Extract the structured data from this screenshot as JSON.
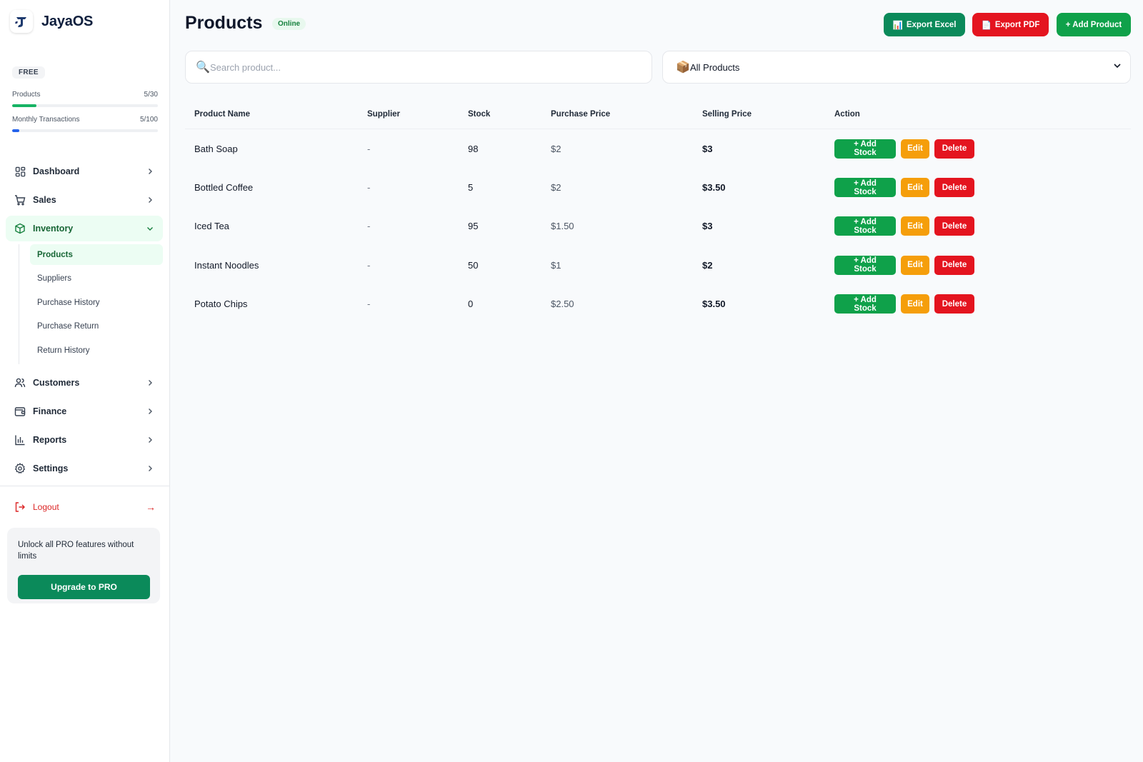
{
  "app": {
    "name": "JayaOS"
  },
  "plan": {
    "badge": "FREE",
    "quotas": [
      {
        "label": "Products",
        "value": "5/30",
        "fraction": 0.167,
        "color": "#16b364"
      },
      {
        "label": "Monthly Transactions",
        "value": "5/100",
        "fraction": 0.05,
        "color": "#2563eb"
      }
    ]
  },
  "sidebar": {
    "items": [
      {
        "label": "Dashboard",
        "icon": "grid-icon"
      },
      {
        "label": "Sales",
        "icon": "cart-icon"
      },
      {
        "label": "Inventory",
        "icon": "box-icon",
        "expanded": true
      },
      {
        "label": "Customers",
        "icon": "users-icon"
      },
      {
        "label": "Finance",
        "icon": "wallet-icon"
      },
      {
        "label": "Reports",
        "icon": "bar-chart-icon"
      },
      {
        "label": "Settings",
        "icon": "gear-icon"
      }
    ],
    "inventory_sub": [
      {
        "label": "Products",
        "active": true
      },
      {
        "label": "Suppliers"
      },
      {
        "label": "Purchase History"
      },
      {
        "label": "Purchase Return"
      },
      {
        "label": "Return History"
      }
    ],
    "logout": {
      "label": "Logout",
      "arrow": "→"
    },
    "promo": {
      "text": "Unlock all PRO features without limits",
      "button": "Upgrade to PRO"
    }
  },
  "header": {
    "title": "Products",
    "status": "Online",
    "buttons": {
      "excel": {
        "label": "Export Excel",
        "icon": "📊"
      },
      "pdf": {
        "label": "Export PDF",
        "icon": "📄"
      },
      "add": {
        "label": "+ Add Product"
      }
    }
  },
  "search": {
    "placeholder": "Search product...",
    "icon": "🔍",
    "value": ""
  },
  "filter": {
    "selected": "All Products",
    "icon": "📦"
  },
  "table": {
    "columns": [
      "Product Name",
      "Supplier",
      "Stock",
      "Purchase Price",
      "Selling Price",
      "Action"
    ],
    "rows": [
      {
        "name": "Bath Soap",
        "supplier": "-",
        "stock": "98",
        "purchase": "$2",
        "selling": "$3"
      },
      {
        "name": "Bottled Coffee",
        "supplier": "-",
        "stock": "5",
        "purchase": "$2",
        "selling": "$3.50"
      },
      {
        "name": "Iced Tea",
        "supplier": "-",
        "stock": "95",
        "purchase": "$1.50",
        "selling": "$3"
      },
      {
        "name": "Instant Noodles",
        "supplier": "-",
        "stock": "50",
        "purchase": "$1",
        "selling": "$2"
      },
      {
        "name": "Potato Chips",
        "supplier": "-",
        "stock": "0",
        "purchase": "$2.50",
        "selling": "$3.50"
      }
    ],
    "actions": {
      "add_stock": "+ Add Stock",
      "edit": "Edit",
      "delete": "Delete"
    }
  },
  "colors": {
    "primary_green": "#0b8a5a",
    "add_green": "#0fa14a",
    "danger_red": "#e4141f",
    "warning_orange": "#f59e0b",
    "active_bg": "#ecfdf3"
  }
}
